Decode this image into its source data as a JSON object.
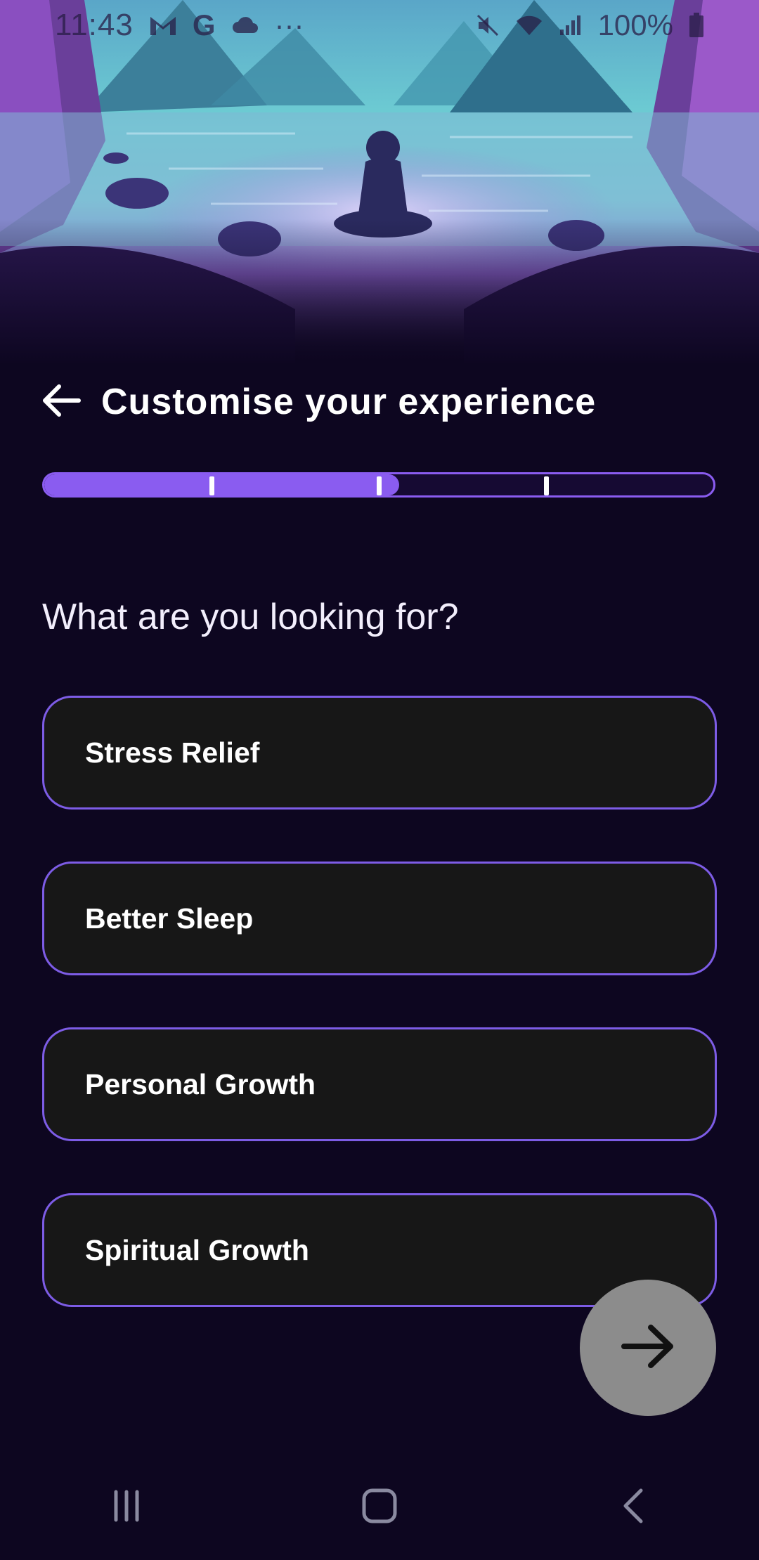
{
  "status_bar": {
    "time": "11:43",
    "battery": "100%",
    "icons": [
      "gmail-icon",
      "google-icon",
      "cloud-icon",
      "more-dots-icon",
      "mute-icon",
      "wifi-icon",
      "signal-icon",
      "battery-icon"
    ]
  },
  "header": {
    "title": "Customise your experience",
    "back_icon": "arrow-left-icon"
  },
  "progress": {
    "fraction": 0.53,
    "segments": 4,
    "fill_color": "#8a5cf0"
  },
  "question": "What are you looking for?",
  "options": [
    {
      "label": "Stress Relief"
    },
    {
      "label": "Better Sleep"
    },
    {
      "label": "Personal Growth"
    },
    {
      "label": "Spiritual Growth"
    }
  ],
  "next_button": {
    "icon": "arrow-right-icon",
    "color": "#8c8c8c"
  },
  "nav_bar": {
    "icons": [
      "recent-apps-icon",
      "home-icon",
      "back-icon"
    ]
  },
  "colors": {
    "background": "#0d0620",
    "accent": "#8a5cf0",
    "option_bg": "#171717"
  }
}
